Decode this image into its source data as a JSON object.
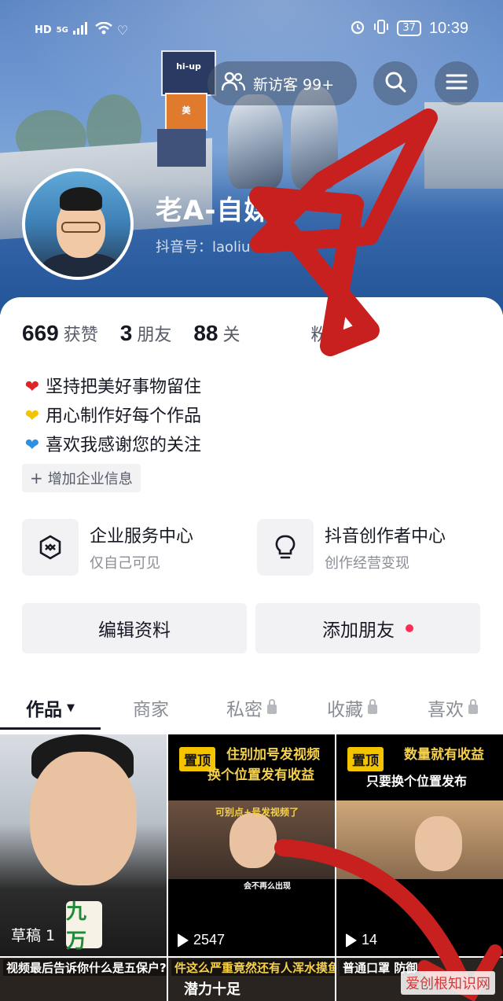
{
  "status_bar": {
    "left_label": "HD",
    "signal_label": "5G",
    "battery": "37",
    "time": "10:39"
  },
  "header": {
    "visitors_label": "新访客 99+",
    "name": "老A-自媒体",
    "douyin_id": "抖音号：laoliu"
  },
  "stats": [
    {
      "num": "669",
      "label": "获赞"
    },
    {
      "num": "3",
      "label": "朋友"
    },
    {
      "num": "88",
      "label": "关"
    },
    {
      "num": "",
      "label": "粉丝"
    }
  ],
  "bio": [
    {
      "icon": "red-heart",
      "text": "坚持把美好事物留住"
    },
    {
      "icon": "yellow-heart",
      "text": "用心制作好每个作品"
    },
    {
      "icon": "blue-heart",
      "text": "喜欢我感谢您的关注"
    }
  ],
  "add_info": "增加企业信息",
  "services": [
    {
      "title": "企业服务中心",
      "subtitle": "仅自己可见"
    },
    {
      "title": "抖音创作者中心",
      "subtitle": "创作经营变现"
    }
  ],
  "buttons": {
    "edit": "编辑资料",
    "add_friend": "添加朋友"
  },
  "tabs": [
    {
      "label": "作品",
      "active": true
    },
    {
      "label": "商家",
      "active": false
    },
    {
      "label": "私密",
      "active": false
    },
    {
      "label": "收藏",
      "active": false
    },
    {
      "label": "喜欢",
      "active": false
    }
  ],
  "videos": {
    "v1": {
      "draft_label": "草稿 1",
      "tile_text": "九万"
    },
    "v2": {
      "pin": "置顶",
      "caption_line1": "住别加号发视频",
      "caption_line2": "换个位置发有收益",
      "caption_small": "可别点+号发视频了",
      "caption_tag": "会不再么出现",
      "plays": "2547"
    },
    "v3": {
      "pin": "置顶",
      "caption_line1": "数量就有收益",
      "caption_line2": "只要换个位置发布",
      "plays": "14"
    },
    "row2": [
      {
        "caption": "视频最后告诉你什么是五保户?"
      },
      {
        "caption": "件这么严重竟然还有人浑水摸鱼",
        "sub": "潜力十足"
      },
      {
        "caption": "普通口罩   防御"
      }
    ]
  },
  "watermark": "爱创根知识网",
  "colors": {
    "accent_red": "#fe2c55",
    "pin_yellow": "#f5c400",
    "annotation_red": "#c7201f"
  }
}
